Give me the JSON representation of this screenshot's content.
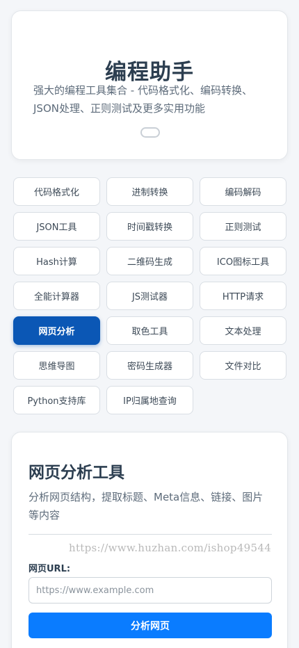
{
  "hero": {
    "title": "编程助手",
    "subtitle": "强大的编程工具集合 - 代码格式化、编码转换、JSON处理、正则测试及更多实用功能"
  },
  "tools": [
    {
      "label": "代码格式化",
      "active": false
    },
    {
      "label": "进制转换",
      "active": false
    },
    {
      "label": "编码解码",
      "active": false
    },
    {
      "label": "JSON工具",
      "active": false
    },
    {
      "label": "时间戳转换",
      "active": false
    },
    {
      "label": "正则测试",
      "active": false
    },
    {
      "label": "Hash计算",
      "active": false
    },
    {
      "label": "二维码生成",
      "active": false
    },
    {
      "label": "ICO图标工具",
      "active": false
    },
    {
      "label": "全能计算器",
      "active": false
    },
    {
      "label": "JS测试器",
      "active": false
    },
    {
      "label": "HTTP请求",
      "active": false
    },
    {
      "label": "网页分析",
      "active": true
    },
    {
      "label": "取色工具",
      "active": false
    },
    {
      "label": "文本处理",
      "active": false
    },
    {
      "label": "思维导图",
      "active": false
    },
    {
      "label": "密码生成器",
      "active": false
    },
    {
      "label": "文件对比",
      "active": false
    },
    {
      "label": "Python支持库",
      "active": false
    },
    {
      "label": "IP归属地查询",
      "active": false
    }
  ],
  "panel": {
    "title": "网页分析工具",
    "description": "分析网页结构，提取标题、Meta信息、链接、图片等内容",
    "watermark": "https://www.huzhan.com/ishop49544",
    "url_label": "网页URL:",
    "url_placeholder": "https://www.example.com",
    "url_value": "",
    "submit_label": "分析网页"
  },
  "colors": {
    "accent": "#0a7cff",
    "active_tab": "#0b57b5"
  }
}
